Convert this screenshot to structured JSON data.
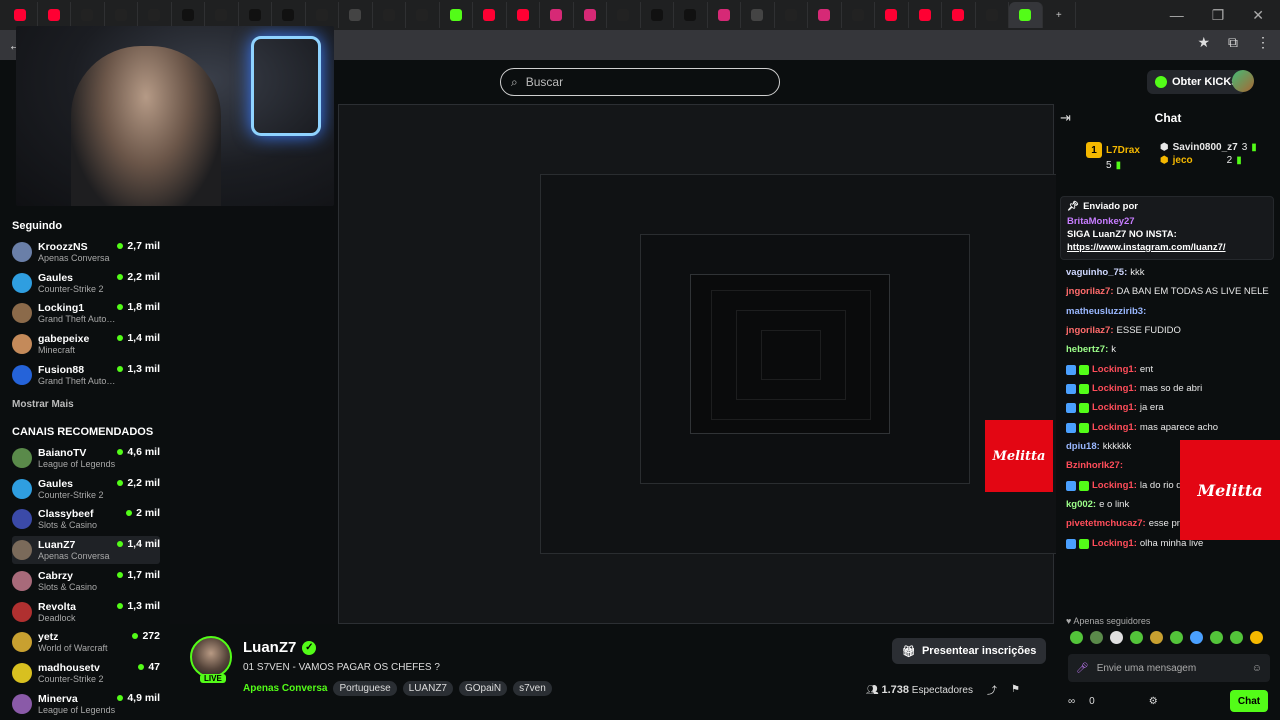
{
  "browser": {
    "tabs": [
      {
        "icon": "youtube",
        "color": "#ff0033"
      },
      {
        "icon": "youtube",
        "color": "#ff0033"
      },
      {
        "icon": "tiktok",
        "color": "#222"
      },
      {
        "icon": "tiktok",
        "color": "#222"
      },
      {
        "icon": "tiktok",
        "color": "#222"
      },
      {
        "icon": "x",
        "color": "#111"
      },
      {
        "icon": "tiktok",
        "color": "#222"
      },
      {
        "icon": "x",
        "color": "#111"
      },
      {
        "icon": "x",
        "color": "#111"
      },
      {
        "icon": "tiktok",
        "color": "#222"
      },
      {
        "icon": "github",
        "color": "#444"
      },
      {
        "icon": "tiktok",
        "color": "#222"
      },
      {
        "icon": "tiktok",
        "color": "#222"
      },
      {
        "icon": "kick",
        "color": "#53fc18"
      },
      {
        "icon": "youtube",
        "color": "#ff0033"
      },
      {
        "icon": "youtube",
        "color": "#ff0033"
      },
      {
        "icon": "instagram",
        "color": "#d62976"
      },
      {
        "icon": "instagram",
        "color": "#d62976"
      },
      {
        "icon": "tiktok",
        "color": "#222"
      },
      {
        "icon": "x",
        "color": "#111"
      },
      {
        "icon": "x",
        "color": "#111"
      },
      {
        "icon": "instagram",
        "color": "#d62976"
      },
      {
        "icon": "threads",
        "color": "#444"
      },
      {
        "icon": "tiktok",
        "color": "#222"
      },
      {
        "icon": "instagram",
        "color": "#d62976"
      },
      {
        "icon": "tiktok",
        "color": "#222"
      },
      {
        "icon": "youtube",
        "color": "#ff0033"
      },
      {
        "icon": "youtube",
        "color": "#ff0033"
      },
      {
        "icon": "youtube",
        "color": "#ff0033"
      },
      {
        "icon": "tiktok",
        "color": "#222"
      },
      {
        "icon": "kick",
        "color": "#53fc18"
      }
    ],
    "new_tab_label": "+"
  },
  "header": {
    "search_placeholder": "Buscar",
    "kicks_button": "Obter KICKs"
  },
  "sidebar": {
    "following_title": "Seguindo",
    "following": [
      {
        "name": "KroozzNS",
        "category": "Apenas Conversa",
        "viewers": "2,7 mil",
        "color": "#6a7fa8"
      },
      {
        "name": "Gaules",
        "category": "Counter-Strike 2",
        "viewers": "2,2 mil",
        "color": "#2f9ee0"
      },
      {
        "name": "Locking1",
        "category": "Grand Theft Auto V...",
        "viewers": "1,8 mil",
        "color": "#8b6a4a"
      },
      {
        "name": "gabepeixe",
        "category": "Minecraft",
        "viewers": "1,4 mil",
        "color": "#c48a5a"
      },
      {
        "name": "Fusion88",
        "category": "Grand Theft Auto V...",
        "viewers": "1,3 mil",
        "color": "#2563d9"
      }
    ],
    "show_more": "Mostrar Mais",
    "recommended_title": "CANAIS RECOMENDADOS",
    "recommended": [
      {
        "name": "BaianoTV",
        "category": "League of Legends",
        "viewers": "4,6 mil",
        "color": "#5a8a4a"
      },
      {
        "name": "Gaules",
        "category": "Counter-Strike 2",
        "viewers": "2,2 mil",
        "color": "#2f9ee0"
      },
      {
        "name": "Classybeef",
        "category": "Slots & Casino",
        "viewers": "2 mil",
        "color": "#3b4aa8"
      },
      {
        "name": "LuanZ7",
        "category": "Apenas Conversa",
        "viewers": "1,4 mil",
        "color": "#7a6a5a"
      },
      {
        "name": "Cabrzy",
        "category": "Slots & Casino",
        "viewers": "1,7 mil",
        "color": "#a86a7a"
      },
      {
        "name": "Revolta",
        "category": "Deadlock",
        "viewers": "1,3 mil",
        "color": "#b03030"
      },
      {
        "name": "yetz",
        "category": "World of Warcraft",
        "viewers": "272",
        "color": "#c8a030"
      },
      {
        "name": "madhousetv",
        "category": "Counter-Strike 2",
        "viewers": "47",
        "color": "#d8c020"
      },
      {
        "name": "Minerva",
        "category": "League of Legends",
        "viewers": "4,9 mil",
        "color": "#8a5aa8"
      }
    ]
  },
  "stream": {
    "streamer": "LuanZ7",
    "live_label": "LIVE",
    "title": "01 S7VEN - VAMOS PAGAR OS CHEFES ?",
    "category": "Apenas Conversa",
    "tags": [
      "Portuguese",
      "LUANZ7",
      "GOpaiN",
      "s7ven"
    ],
    "subs_button": "Presentear inscrições",
    "viewers": "1.738",
    "viewers_label": "Espectadores",
    "sponsor": "Melitta"
  },
  "chat": {
    "title": "Chat",
    "leaderboard": [
      {
        "rank": "1",
        "name": "L7Drax",
        "count": "5",
        "color": "#f5b800"
      },
      {
        "name": "Savin0800_z7",
        "count": "3",
        "color": "#fff"
      },
      {
        "name": "jeco",
        "count": "2",
        "color": "#f5b800"
      }
    ],
    "pinned": {
      "title": "Enviado por",
      "user": "BritaMonkey27",
      "message": "SIGA LuanZ7 NO INSTA:",
      "link": "https://www.instagram.com/luanz7/"
    },
    "messages": [
      {
        "user": "vaguinho_75:",
        "text": "kkk",
        "color": "#cfd8ff"
      },
      {
        "user": "jngorilaz7:",
        "text": "DA BAN EM TODAS AS LIVE NELE",
        "color": "#ff6b6b"
      },
      {
        "user": "matheusluzzirib3:",
        "text": "",
        "color": "#9ab8ff"
      },
      {
        "user": "jngorilaz7:",
        "text": "ESSE FUDIDO",
        "color": "#ff6b6b"
      },
      {
        "user": "hebertz7:",
        "text": "k",
        "color": "#9dff8a"
      },
      {
        "user": "Locking1:",
        "text": "ent",
        "color": "#ff4d5a"
      },
      {
        "user": "Locking1:",
        "text": "mas so de abri",
        "color": "#ff4d5a"
      },
      {
        "user": "Locking1:",
        "text": "ja era",
        "color": "#ff4d5a"
      },
      {
        "user": "Locking1:",
        "text": "mas aparece acho",
        "color": "#ff4d5a"
      },
      {
        "user": "dpiu18:",
        "text": "kkkkkk",
        "color": "#9ab8ff"
      },
      {
        "user": "Bzinhorlk27:",
        "text": "",
        "color": "#ff4d5a"
      },
      {
        "user": "Locking1:",
        "text": "la do rio de",
        "color": "#ff4d5a"
      },
      {
        "user": "kg002:",
        "text": "e o link",
        "color": "#9dff8a"
      },
      {
        "user": "pivetetmchucaz7:",
        "text": "esse pnc joga ele no pneu",
        "color": "#ff4d5a"
      },
      {
        "user": "Locking1:",
        "text": "olha minha live",
        "color": "#ff4d5a"
      }
    ],
    "followers_only": "Apenas seguidores",
    "input_placeholder": "Envie uma mensagem",
    "kicks_count": "0",
    "send_label": "Chat",
    "infinity": "∞"
  }
}
